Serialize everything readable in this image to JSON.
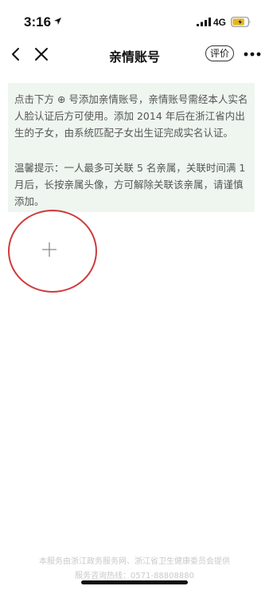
{
  "status_bar": {
    "time": "3:16",
    "network": "4G"
  },
  "nav": {
    "title": "亲情账号",
    "rate_label": "评价"
  },
  "notice": {
    "paragraph_1": "点击下方 ⊕ 号添加亲情账号，亲情账号需经本人实名人脸认证后方可使用。添加 2014 年后在浙江省内出生的子女，由系统匹配子女出生证完成实名认证。",
    "paragraph_2": "温馨提示：一人最多可关联 5 名亲属，关联时间满 1 月后，长按亲属头像，方可解除关联该亲属，请谨慎添加。"
  },
  "footer": {
    "line_1": "本服务由浙江政务服务网、浙江省卫生健康委员会提供",
    "line_2": "服务咨询热线：0571-88808880"
  },
  "colors": {
    "notice_background": "#eef6ef",
    "annotation_circle": "#cf3a3a",
    "footer_text": "#c9c9c9"
  },
  "icons": {
    "back": "chevron-left-icon",
    "close": "close-icon",
    "more": "more-dots-icon",
    "add": "plus-icon"
  }
}
